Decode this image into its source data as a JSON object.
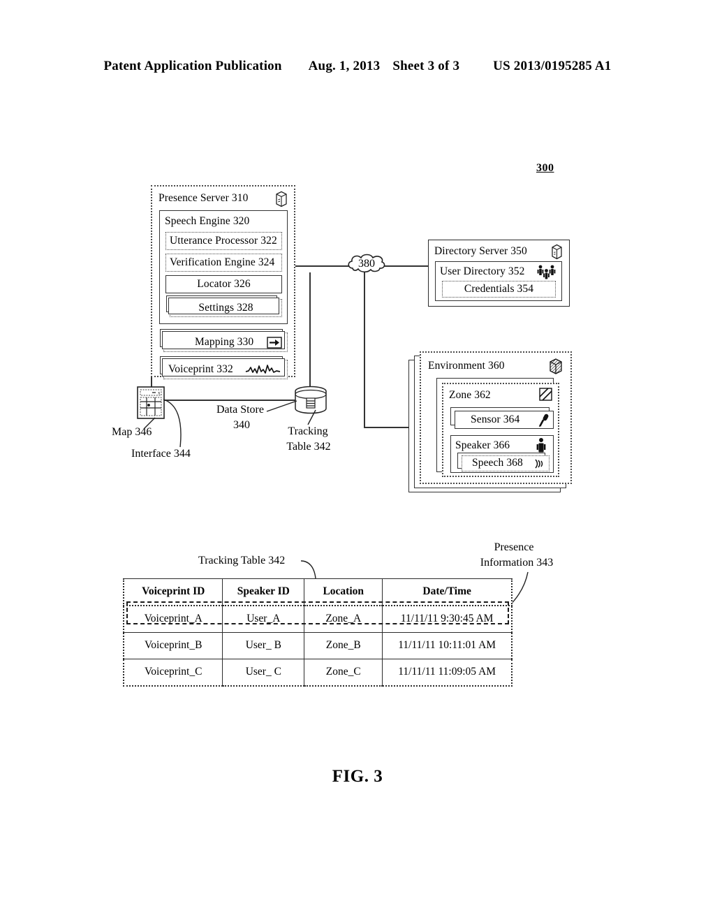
{
  "page_header": {
    "publication": "Patent Application Publication",
    "date": "Aug. 1, 2013",
    "sheet": "Sheet 3 of 3",
    "patent_number": "US 2013/0195285 A1"
  },
  "figure": {
    "caption": "FIG. 3",
    "system_ref": "300"
  },
  "diagram": {
    "presence_server": {
      "label": "Presence Server 310",
      "icon": "server-icon",
      "speech_engine": {
        "label": "Speech Engine 320",
        "components": [
          {
            "label": "Utterance Processor 322",
            "icon": null
          },
          {
            "label": "Verification Engine 324",
            "icon": null
          },
          {
            "label": "Locator 326",
            "icon": null
          },
          {
            "label": "Settings 328",
            "icon": null
          }
        ]
      },
      "modules": [
        {
          "label": "Mapping 330",
          "icon": "mapping-arrow-icon"
        },
        {
          "label": "Voiceprint 332",
          "icon": "waveform-icon"
        }
      ]
    },
    "network_cloud": {
      "label": "380",
      "icon": "cloud-icon"
    },
    "directory_server": {
      "label": "Directory Server 350",
      "icon": "server-icon",
      "user_directory": {
        "label": "User Directory 352",
        "icon": "people-icon",
        "credentials": {
          "label": "Credentials 354"
        }
      }
    },
    "environment": {
      "label": "Environment 360",
      "icon": "cube-icon",
      "zone": {
        "label": "Zone 362",
        "icon": "hatched-square-icon",
        "sensor": {
          "label": "Sensor 364",
          "icon": "microphone-icon"
        },
        "speaker": {
          "label": "Speaker 366",
          "icon": "person-icon",
          "speech": {
            "label": "Speech 368",
            "icon": "sound-waves-icon"
          }
        }
      }
    },
    "data_store": {
      "label_line1": "Data Store",
      "label_line2": "340",
      "icon": "database-cylinder-icon"
    },
    "tracking_table_ref": {
      "label_line1": "Tracking",
      "label_line2": "Table 342"
    },
    "interface": {
      "label": "Interface 344",
      "map": {
        "label": "Map 346",
        "icon": "map-window-icon"
      }
    }
  },
  "tracking_table": {
    "title": "Tracking Table 342",
    "callout": {
      "line1": "Presence",
      "line2": "Information 343"
    },
    "columns": [
      "Voiceprint ID",
      "Speaker ID",
      "Location",
      "Date/Time"
    ],
    "rows": [
      {
        "voiceprint_id": "Voiceprint_A",
        "speaker_id": "User_A",
        "location": "Zone_A",
        "datetime": "11/11/11 9:30:45 AM",
        "highlighted": true
      },
      {
        "voiceprint_id": "Voiceprint_B",
        "speaker_id": "User_ B",
        "location": "Zone_B",
        "datetime": "11/11/11 10:11:01 AM",
        "highlighted": false
      },
      {
        "voiceprint_id": "Voiceprint_C",
        "speaker_id": "User_ C",
        "location": "Zone_C",
        "datetime": "11/11/11 11:09:05 AM",
        "highlighted": false
      }
    ]
  },
  "colors": {
    "ink": "#000000",
    "line": "#333333",
    "paper": "#ffffff"
  }
}
